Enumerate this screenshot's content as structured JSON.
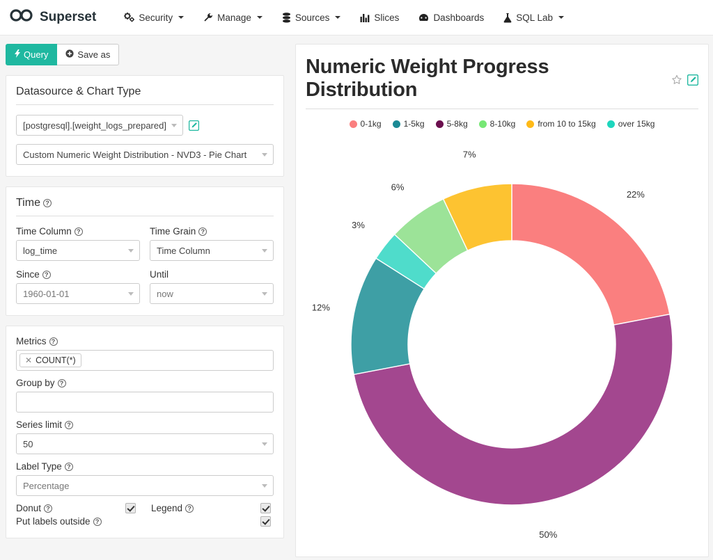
{
  "navbar": {
    "brand": "Superset",
    "brand_icon": "infinity-logo-icon",
    "items": [
      {
        "label": "Security",
        "icon": "gears-icon",
        "caret": true
      },
      {
        "label": "Manage",
        "icon": "wrench-icon",
        "caret": true
      },
      {
        "label": "Sources",
        "icon": "database-icon",
        "caret": true
      },
      {
        "label": "Slices",
        "icon": "bar-chart-icon",
        "caret": false
      },
      {
        "label": "Dashboards",
        "icon": "dashboard-icon",
        "caret": false
      },
      {
        "label": "SQL Lab",
        "icon": "flask-icon",
        "caret": true
      }
    ]
  },
  "toolbar": {
    "query_label": "Query",
    "query_icon": "bolt-icon",
    "save_label": "Save as",
    "save_icon": "plus-circle-icon"
  },
  "datasource_panel": {
    "title": "Datasource & Chart Type",
    "datasource_value": "[postgresql].[weight_logs_prepared]",
    "edit_icon": "edit-datasource-icon",
    "viz_type_value": "Custom Numeric Weight Distribution - NVD3 - Pie Chart"
  },
  "time_panel": {
    "title": "Time",
    "time_column_label": "Time Column",
    "time_column_value": "log_time",
    "time_grain_label": "Time Grain",
    "time_grain_value": "Time Column",
    "since_label": "Since",
    "since_value": "1960-01-01",
    "until_label": "Until",
    "until_value": "now"
  },
  "metrics_panel": {
    "metrics_label": "Metrics",
    "metric_token": "COUNT(*)",
    "remove_icon": "remove-metric-icon",
    "groupby_label": "Group by",
    "groupby_value": "",
    "series_limit_label": "Series limit",
    "series_limit_value": "50",
    "label_type_label": "Label Type",
    "label_type_value": "Percentage",
    "donut_label": "Donut",
    "donut_checked": true,
    "legend_label": "Legend",
    "legend_checked": true,
    "labels_outside_label": "Put labels outside",
    "labels_outside_checked": true
  },
  "chart": {
    "title": "Numeric Weight Progress Distribution",
    "favorite_icon": "star-outline-icon",
    "edit_icon": "edit-chart-icon"
  },
  "chart_data": {
    "type": "pie",
    "title": "Numeric Weight Progress Distribution",
    "donut": true,
    "label_type": "Percentage",
    "legend_position": "top",
    "labels_outside": true,
    "categories": [
      "0-1kg",
      "1-5kg",
      "5-8kg",
      "8-10kg",
      "from 10 to 15kg",
      "over 15kg"
    ],
    "colors": [
      "#fa7f7f",
      "#3e9fa5",
      "#9e3f85",
      "#94ed92",
      "#fdc12f",
      "#44dbc9"
    ],
    "slice_order": [
      "0-1kg",
      "5-8kg",
      "1-5kg",
      "over 15kg",
      "8-10kg",
      "from 10 to 15kg"
    ],
    "slices": [
      {
        "name": "0-1kg",
        "value": 22,
        "label": "22%",
        "color": "#fa7f7f"
      },
      {
        "name": "5-8kg",
        "value": 50,
        "label": "50%",
        "color": "#a3478f"
      },
      {
        "name": "1-5kg",
        "value": 12,
        "label": "12%",
        "color": "#3e9fa5"
      },
      {
        "name": "over 15kg",
        "value": 3,
        "label": "3%",
        "color": "#4fdccb"
      },
      {
        "name": "8-10kg",
        "value": 6,
        "label": "6%",
        "color": "#9ce398"
      },
      {
        "name": "from 10 to 15kg",
        "value": 7,
        "label": "7%",
        "color": "#fdc331"
      }
    ]
  },
  "colors": {
    "accent": "#1fb8a0",
    "page_bg": "#f5f5f5",
    "panel_bg": "#ffffff"
  }
}
